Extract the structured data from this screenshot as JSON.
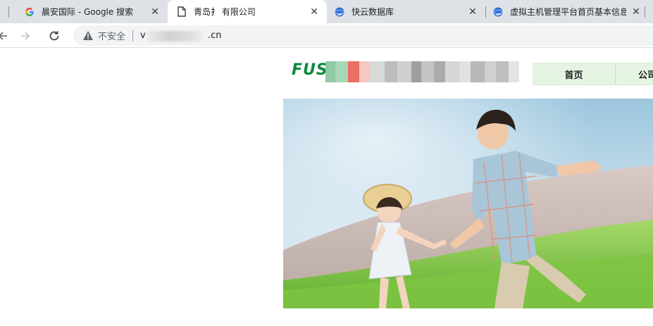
{
  "browser": {
    "tabs": [
      {
        "title": "晨安国际 - Google 搜索",
        "icon": "google-g-icon",
        "active": false
      },
      {
        "title": "青岛扌          有限公司",
        "icon": "page-document-icon",
        "active": true
      },
      {
        "title": "快云数据库",
        "icon": "cloud-globe-icon",
        "active": false
      },
      {
        "title": "虚拟主机管理平台首页基本信息-",
        "icon": "cloud-globe-icon",
        "active": false
      }
    ],
    "close_glyph": "✕",
    "security_label": "不安全",
    "url_prefix": "v",
    "url_suffix": ".cn"
  },
  "site": {
    "logo_text": "FUS",
    "nav": [
      "首页",
      "公司"
    ],
    "colors": {
      "brand_green": "#0b8a3a",
      "nav_bg": "#e6f4e4"
    }
  }
}
